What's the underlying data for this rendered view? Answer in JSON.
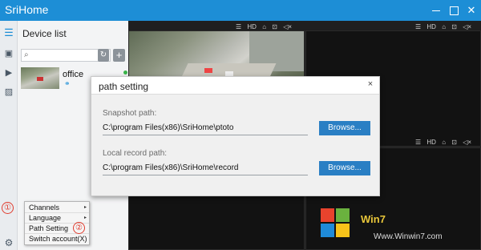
{
  "app": {
    "title": "SriHome"
  },
  "window_controls": {
    "minimize_icon": "minimize-icon",
    "maximize_icon": "maximize-icon",
    "close_glyph": "✕"
  },
  "rail": {
    "menu_glyph": "☰",
    "cam_glyph": "▣",
    "play_glyph": "▶",
    "img_glyph": "▨",
    "gear_glyph": "⚙"
  },
  "device_panel": {
    "header": "Device list",
    "search": {
      "placeholder": "",
      "icon": "search-icon",
      "glyph": "⌕"
    },
    "refresh_glyph": "↻",
    "add_glyph": "+",
    "devices": [
      {
        "name": "office",
        "status_color": "#3ab54a",
        "link_glyph": "⚭"
      }
    ]
  },
  "video": {
    "toolbar_items": [
      "☰",
      "HD",
      "⌂",
      "⊡",
      "◁×"
    ]
  },
  "dialog": {
    "title": "path setting",
    "close_glyph": "×",
    "snapshot_label": "Snapshot path:",
    "snapshot_value": "C:\\program Files(x86)\\SriHome\\ptoto",
    "record_label": "Local record path:",
    "record_value": "C:\\program Files(x86)\\SriHome\\record",
    "browse_label": "Browse..."
  },
  "context_menu": {
    "items": [
      {
        "label": "Channels",
        "has_submenu": true
      },
      {
        "label": "Language",
        "has_submenu": true
      },
      {
        "label": "Path Setting",
        "has_submenu": false
      },
      {
        "label": "Switch account(X)",
        "has_submenu": false
      }
    ],
    "submenu_glyph": "▸"
  },
  "annotations": {
    "marker_1": "①",
    "marker_2": "②"
  },
  "watermark": {
    "text": "Win7",
    "url": "Www.Winwin7.com"
  },
  "colors": {
    "titlebar": "#1d8ed6",
    "button": "#2a7fc4",
    "annotation": "#e03c2e"
  }
}
